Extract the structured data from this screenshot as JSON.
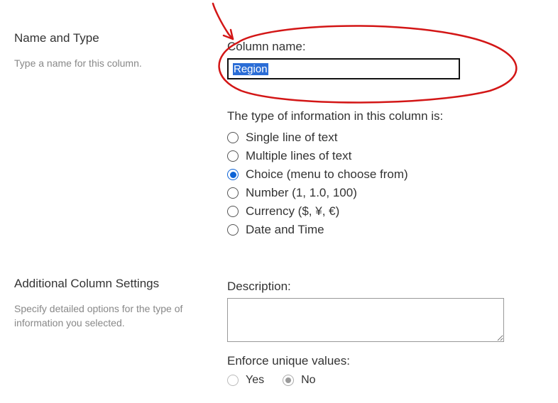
{
  "nameType": {
    "title": "Name and Type",
    "desc": "Type a name for this column.",
    "columnNameLabel": "Column name:",
    "columnNameValue": "Region",
    "typeLabel": "The type of information in this column is:",
    "typeOptions": [
      {
        "label": "Single line of text",
        "checked": false
      },
      {
        "label": "Multiple lines of text",
        "checked": false
      },
      {
        "label": "Choice (menu to choose from)",
        "checked": true
      },
      {
        "label": "Number (1, 1.0, 100)",
        "checked": false
      },
      {
        "label": "Currency ($, ¥, €)",
        "checked": false
      },
      {
        "label": "Date and Time",
        "checked": false
      }
    ]
  },
  "additional": {
    "title": "Additional Column Settings",
    "desc": "Specify detailed options for the type of information you selected.",
    "descriptionLabel": "Description:",
    "descriptionValue": "",
    "enforceLabel": "Enforce unique values:",
    "yesLabel": "Yes",
    "noLabel": "No"
  }
}
